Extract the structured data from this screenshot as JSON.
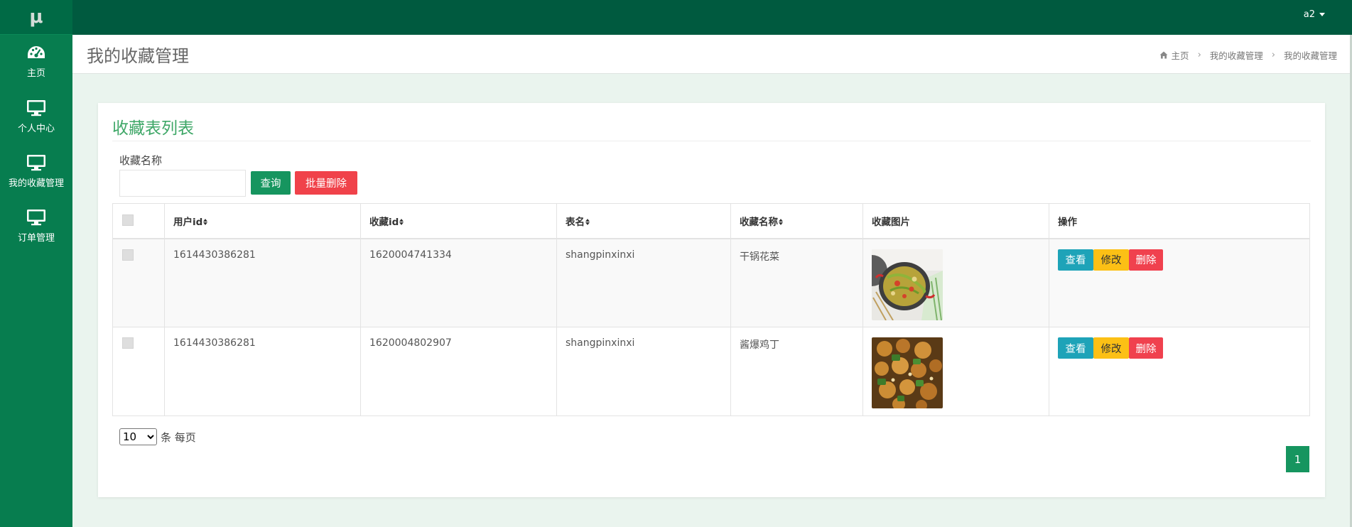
{
  "app": {
    "logo": "μ"
  },
  "topbar": {
    "user": "a2"
  },
  "sidebar": {
    "items": [
      {
        "label": "主页",
        "icon": "dashboard-icon"
      },
      {
        "label": "个人中心",
        "icon": "desktop-icon"
      },
      {
        "label": "我的收藏管理",
        "icon": "desktop-icon"
      },
      {
        "label": "订单管理",
        "icon": "desktop-icon"
      }
    ]
  },
  "header": {
    "title": "我的收藏管理",
    "breadcrumb": [
      "主页",
      "我的收藏管理",
      "我的收藏管理"
    ]
  },
  "card": {
    "title": "收藏表列表",
    "search_label": "收藏名称",
    "search_value": "",
    "query_button": "查询",
    "batch_delete_button": "批量删除"
  },
  "table": {
    "columns": [
      "用户id",
      "收藏id",
      "表名",
      "收藏名称",
      "收藏图片",
      "操作"
    ],
    "rows": [
      {
        "user_id": "1614430386281",
        "fav_id": "1620004741334",
        "table": "shangpinxinxi",
        "name": "干锅花菜",
        "image": "dry-pot-cauliflower-photo"
      },
      {
        "user_id": "1614430386281",
        "fav_id": "1620004802907",
        "table": "shangpinxinxi",
        "name": "酱爆鸡丁",
        "image": "diced-chicken-photo"
      }
    ],
    "actions": {
      "view": "查看",
      "edit": "修改",
      "delete": "删除"
    }
  },
  "pagination": {
    "page_size": "10",
    "page_size_options": [
      "10"
    ],
    "page_size_suffix": "条 每页",
    "current_page": "1"
  },
  "colors": {
    "topbar": "#005a3f",
    "sidebar": "#077d4f",
    "accent": "#16955f",
    "danger": "#f0424a",
    "info": "#1ea3b8",
    "warning": "#fcc015"
  }
}
